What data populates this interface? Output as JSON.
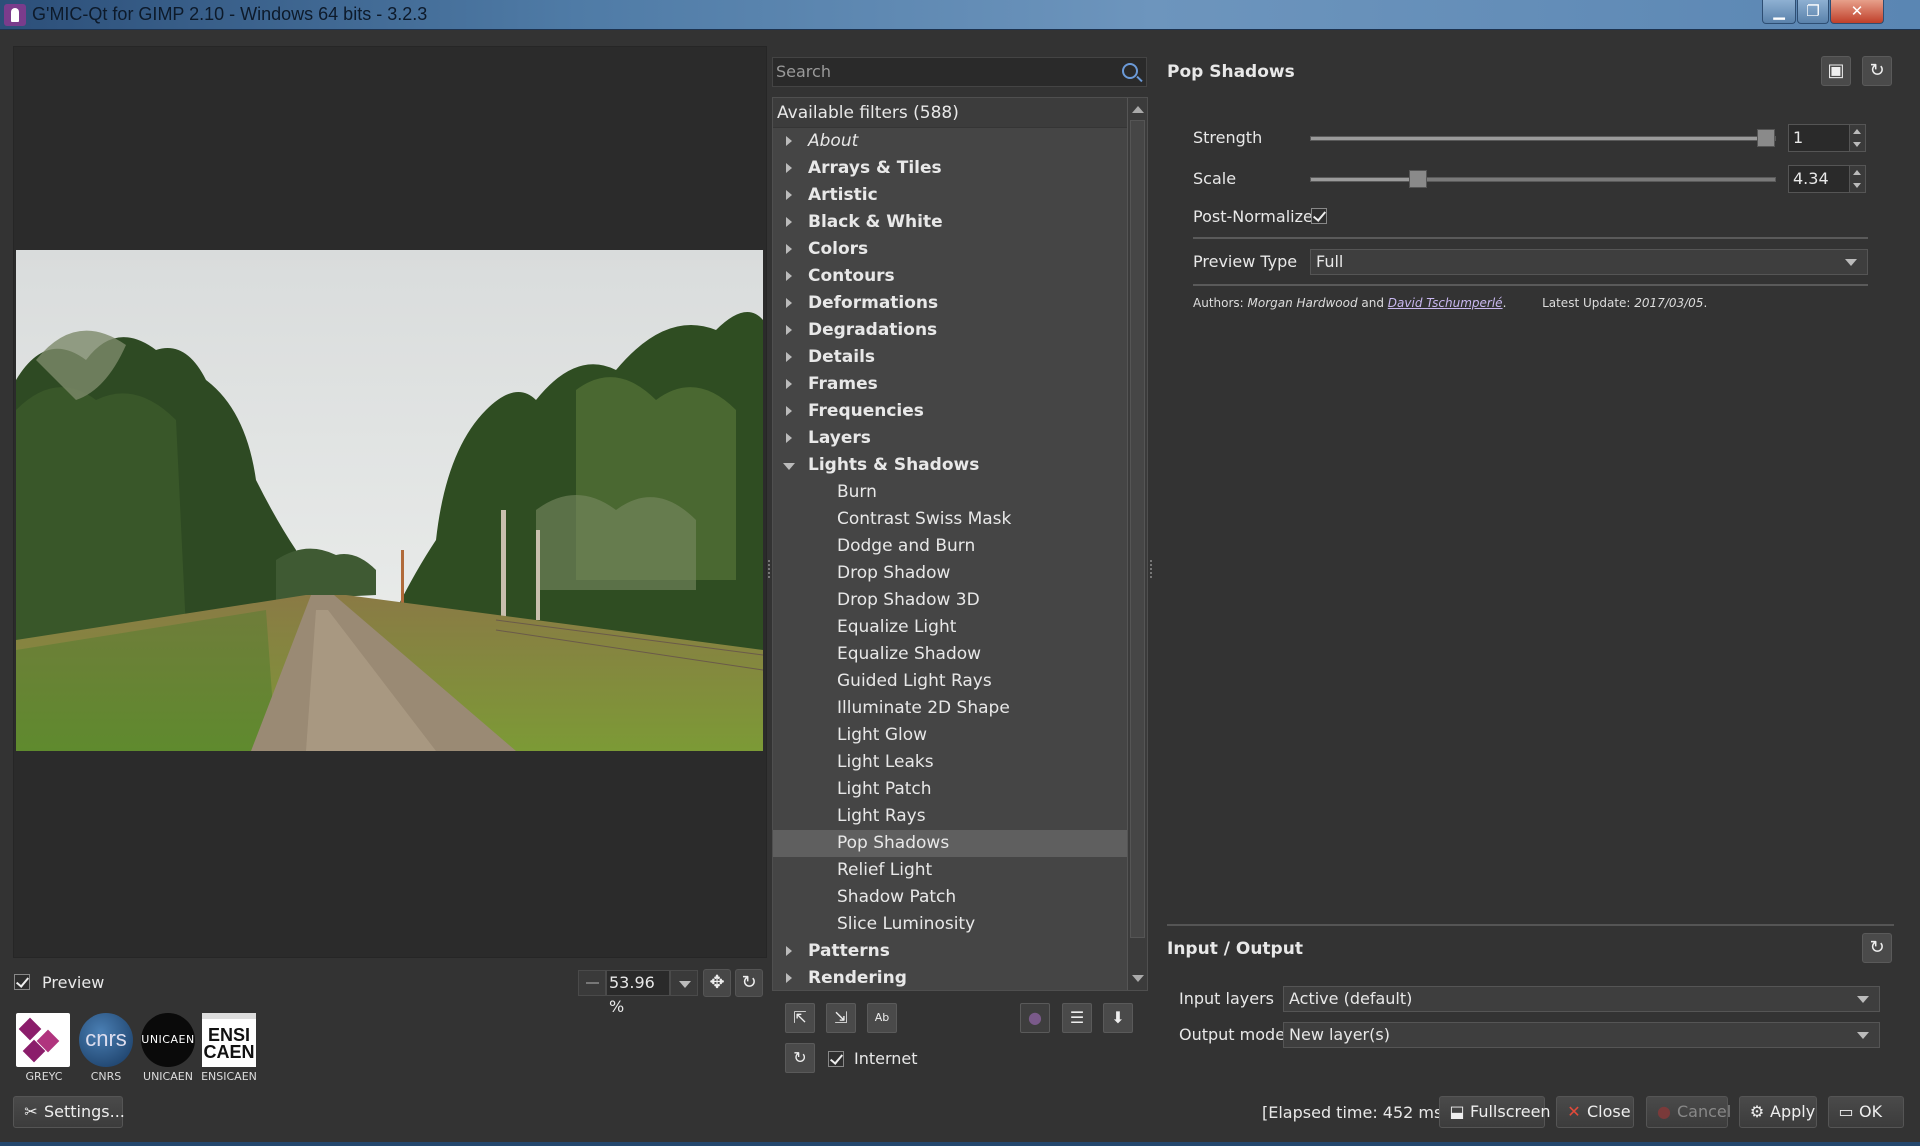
{
  "window": {
    "title": "G'MIC-Qt for GIMP 2.10 - Windows 64 bits - 3.2.3",
    "min_glyph": "▁",
    "max_glyph": "❐",
    "close_glyph": "✕"
  },
  "preview": {
    "checkbox_label": "Preview",
    "checked": true,
    "zoom_value": "53.96 %"
  },
  "logos": {
    "greyc": "GREYC",
    "cnrs": "CNRS",
    "cnrs_mark": "cnrs",
    "unicaen": "UNICAEN",
    "unicaen_mark": "UNICAEN",
    "ensicaen": "ENSICAEN",
    "ensicaen_mark_top": "ENSI",
    "ensicaen_mark_bottom": "CAEN"
  },
  "settings_button": "Settings...",
  "filters": {
    "search_placeholder": "Search",
    "header": "Available filters (588)",
    "rows": [
      {
        "label": "About",
        "kind": "category",
        "italic": true
      },
      {
        "label": "Arrays & Tiles",
        "kind": "category"
      },
      {
        "label": "Artistic",
        "kind": "category"
      },
      {
        "label": "Black & White",
        "kind": "category"
      },
      {
        "label": "Colors",
        "kind": "category"
      },
      {
        "label": "Contours",
        "kind": "category"
      },
      {
        "label": "Deformations",
        "kind": "category"
      },
      {
        "label": "Degradations",
        "kind": "category"
      },
      {
        "label": "Details",
        "kind": "category"
      },
      {
        "label": "Frames",
        "kind": "category"
      },
      {
        "label": "Frequencies",
        "kind": "category"
      },
      {
        "label": "Layers",
        "kind": "category"
      },
      {
        "label": "Lights & Shadows",
        "kind": "category",
        "expanded": true
      },
      {
        "label": "Burn",
        "kind": "leaf"
      },
      {
        "label": "Contrast Swiss Mask",
        "kind": "leaf"
      },
      {
        "label": "Dodge and Burn",
        "kind": "leaf"
      },
      {
        "label": "Drop Shadow",
        "kind": "leaf"
      },
      {
        "label": "Drop Shadow 3D",
        "kind": "leaf"
      },
      {
        "label": "Equalize Light",
        "kind": "leaf"
      },
      {
        "label": "Equalize Shadow",
        "kind": "leaf"
      },
      {
        "label": "Guided Light Rays",
        "kind": "leaf"
      },
      {
        "label": "Illuminate 2D Shape",
        "kind": "leaf"
      },
      {
        "label": "Light Glow",
        "kind": "leaf"
      },
      {
        "label": "Light Leaks",
        "kind": "leaf"
      },
      {
        "label": "Light Patch",
        "kind": "leaf"
      },
      {
        "label": "Light Rays",
        "kind": "leaf"
      },
      {
        "label": "Pop Shadows",
        "kind": "leaf",
        "selected": true
      },
      {
        "label": "Relief Light",
        "kind": "leaf"
      },
      {
        "label": "Shadow Patch",
        "kind": "leaf"
      },
      {
        "label": "Slice Luminosity",
        "kind": "leaf"
      },
      {
        "label": "Patterns",
        "kind": "category"
      },
      {
        "label": "Rendering",
        "kind": "category"
      }
    ],
    "internet_label": "Internet",
    "internet_checked": true
  },
  "filter_params": {
    "name": "Pop Shadows",
    "strength": {
      "label": "Strength",
      "value": "1",
      "fraction": 1.0
    },
    "scale": {
      "label": "Scale",
      "value": "4.34",
      "fraction": 0.22
    },
    "post_normalize": {
      "label": "Post-Normalize",
      "checked": true
    },
    "preview_type": {
      "label": "Preview Type",
      "value": "Full"
    },
    "authors_prefix": "Authors: ",
    "author1": "Morgan Hardwood",
    "and": " and ",
    "author2": "David Tschumperlé",
    "period": ".",
    "latest_update_label": "Latest Update: ",
    "latest_update_value": "2017/03/05",
    "latest_update_period": "."
  },
  "io": {
    "title": "Input / Output",
    "input_layers_label": "Input layers",
    "input_layers_value": "Active (default)",
    "output_mode_label": "Output mode",
    "output_mode_value": "New layer(s)"
  },
  "footer": {
    "elapsed": "[Elapsed time: 452 ms]",
    "fullscreen": "Fullscreen",
    "close": "Close",
    "cancel": "Cancel",
    "apply": "Apply",
    "ok": "OK"
  },
  "colors": {
    "background": "#333333",
    "selected_row": "#5f5f5f",
    "link": "#c9b8f0",
    "titlebar": "#4f7ba6"
  }
}
